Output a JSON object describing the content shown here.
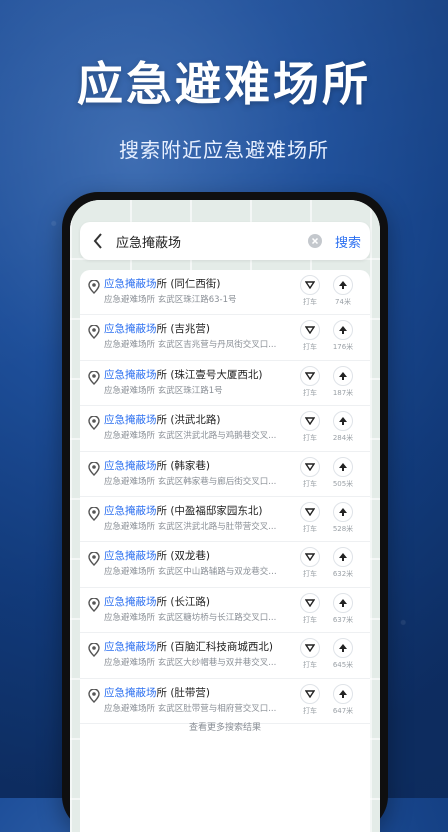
{
  "hero": {
    "title": "应急避难场所",
    "subtitle": "搜索附近应急避难场所"
  },
  "search": {
    "query": "应急掩蔽场",
    "button_label": "搜索"
  },
  "results": [
    {
      "keyword": "应急掩蔽场",
      "rest": "所 (同仁西街)",
      "address": "应急避难场所  玄武区珠江路63-1号",
      "taxi_label": "打车",
      "distance": "74米"
    },
    {
      "keyword": "应急掩蔽场",
      "rest": "所 (吉兆营)",
      "address": "应急避难场所  玄武区吉兆营与丹凤街交叉口...",
      "taxi_label": "打车",
      "distance": "176米"
    },
    {
      "keyword": "应急掩蔽场",
      "rest": "所 (珠江壹号大厦西北)",
      "address": "应急避难场所  玄武区珠江路1号",
      "taxi_label": "打车",
      "distance": "187米"
    },
    {
      "keyword": "应急掩蔽场",
      "rest": "所 (洪武北路)",
      "address": "应急避难场所  玄武区洪武北路与鸡鹅巷交叉...",
      "taxi_label": "打车",
      "distance": "284米"
    },
    {
      "keyword": "应急掩蔽场",
      "rest": "所 (韩家巷)",
      "address": "应急避难场所  玄武区韩家巷与廊后街交叉口...",
      "taxi_label": "打车",
      "distance": "505米"
    },
    {
      "keyword": "应急掩蔽场",
      "rest": "所 (中盈福邸家园东北)",
      "address": "应急避难场所  玄武区洪武北路与肚带营交叉...",
      "taxi_label": "打车",
      "distance": "528米"
    },
    {
      "keyword": "应急掩蔽场",
      "rest": "所 (双龙巷)",
      "address": "应急避难场所  玄武区中山路辅路与双龙巷交叉...",
      "taxi_label": "打车",
      "distance": "632米"
    },
    {
      "keyword": "应急掩蔽场",
      "rest": "所 (长江路)",
      "address": "应急避难场所  玄武区糖坊桥与长江路交叉口...",
      "taxi_label": "打车",
      "distance": "637米"
    },
    {
      "keyword": "应急掩蔽场",
      "rest": "所 (百脑汇科技商城西北)",
      "address": "应急避难场所  玄武区大纱帽巷与双井巷交叉...",
      "taxi_label": "打车",
      "distance": "645米"
    },
    {
      "keyword": "应急掩蔽场",
      "rest": "所 (肚带营)",
      "address": "应急避难场所  玄武区肚带营与相府营交叉口...",
      "taxi_label": "打车",
      "distance": "647米"
    }
  ],
  "more_label": "查看更多搜索结果",
  "icons": {
    "back": "chevron-left-icon",
    "clear": "clear-icon",
    "pin": "location-pin-icon",
    "taxi": "taxi-icon",
    "navigate": "navigate-arrow-icon"
  },
  "colors": {
    "accent": "#2b6ff0",
    "background": "#1e4f9a"
  }
}
